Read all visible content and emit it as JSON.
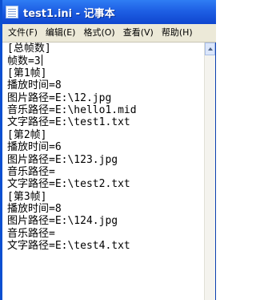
{
  "window": {
    "title": "test1.ini - 记事本"
  },
  "menubar": {
    "items": [
      {
        "label": "文件(F)"
      },
      {
        "label": "编辑(E)"
      },
      {
        "label": "格式(O)"
      },
      {
        "label": "查看(V)"
      },
      {
        "label": "帮助(H)"
      }
    ]
  },
  "editor": {
    "lines": [
      "[总帧数]",
      "帧数=3",
      "[第1帧]",
      "播放时间=8",
      "图片路径=E:\\12.jpg",
      "音乐路径=E:\\hello1.mid",
      "文字路径=E:\\test1.txt",
      "[第2帧]",
      "播放时间=6",
      "图片路径=E:\\123.jpg",
      "音乐路径=",
      "文字路径=E:\\test2.txt",
      "[第3帧]",
      "播放时间=8",
      "图片路径=E:\\124.jpg",
      "音乐路径=",
      "文字路径=E:\\test4.txt"
    ]
  }
}
